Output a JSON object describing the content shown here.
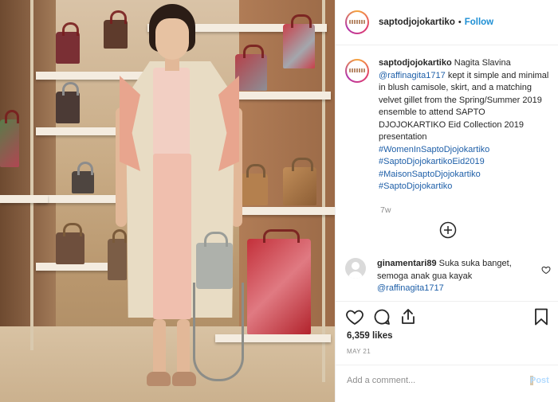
{
  "header": {
    "username": "saptodjojokartiko",
    "separator": "•",
    "follow_label": "Follow"
  },
  "caption": {
    "username": "saptodjojokartiko",
    "text_before_mention": "Nagita Slavina",
    "mention": "@raffinagita1717",
    "text_after_mention": "kept it simple and minimal in blush camisole, skirt, and a matching velvet gillet from the Spring/Summer 2019 ensemble to attend SAPTO DJOJOKARTIKO Eid Collection 2019 presentation",
    "hashtags": [
      "#WomenInSaptoDjojokartiko",
      "#SaptoDjojokartikoEid2019",
      "#MaisonSaptoDjojokartiko",
      "#SaptoDjojokartiko"
    ],
    "age": "7w"
  },
  "comment": {
    "username": "ginamentari89",
    "text": "Suka suka banget, semoga anak gua kayak",
    "mention": "@raffinagita1717"
  },
  "likes": "6,359 likes",
  "date": "MAY 21",
  "add_comment_placeholder": "Add a comment...",
  "post_label": "Post",
  "colors": {
    "link": "#1e5fa8",
    "follow": "#1e8fd4",
    "muted": "#8e8e8e",
    "post_disabled": "#b3dbff"
  },
  "icons": [
    "heart-icon",
    "comment-icon",
    "share-icon",
    "bookmark-icon",
    "add-circle-icon",
    "small-heart-icon"
  ]
}
